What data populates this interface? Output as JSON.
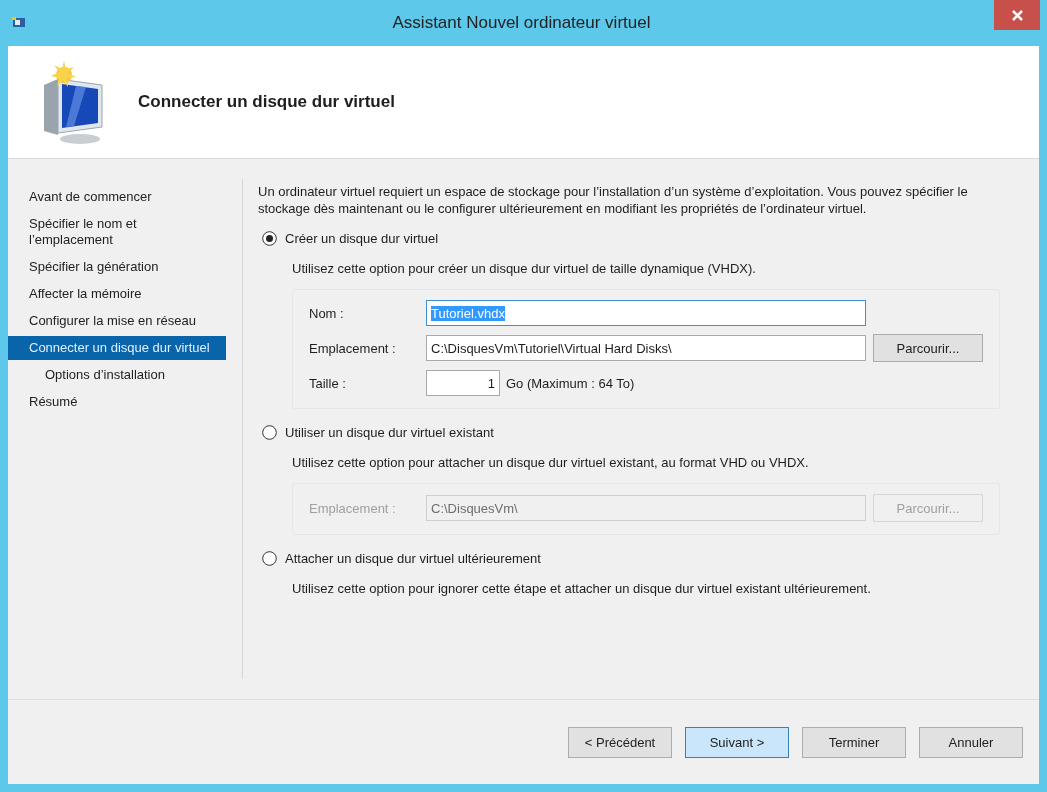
{
  "window": {
    "title": "Assistant Nouvel ordinateur virtuel"
  },
  "header": {
    "title": "Connecter un disque dur virtuel"
  },
  "steps": [
    {
      "label": "Avant de commencer",
      "selected": false
    },
    {
      "label": "Spécifier le nom et l’emplacement",
      "selected": false
    },
    {
      "label": "Spécifier la génération",
      "selected": false
    },
    {
      "label": "Affecter la mémoire",
      "selected": false
    },
    {
      "label": "Configurer la mise en réseau",
      "selected": false
    },
    {
      "label": "Connecter un disque dur virtuel",
      "selected": true,
      "children": [
        {
          "label": "Options d’installation",
          "selected": false
        }
      ]
    },
    {
      "label": "Résumé",
      "selected": false
    }
  ],
  "intro": "Un ordinateur virtuel requiert un espace de stockage pour l’installation d’un système d’exploitation. Vous pouvez spécifier le stockage dès maintenant ou le configurer ultérieurement en modifiant les propriétés de l’ordinateur virtuel.",
  "options": [
    {
      "label": "Créer un disque dur virtuel",
      "selected": true,
      "description": "Utilisez cette option pour créer un disque dur virtuel de taille dynamique (VHDX).",
      "disabled": false,
      "fields": [
        {
          "kind": "text",
          "label": "Nom :",
          "value": "Tutoriel.vhdx",
          "highlighted": true
        },
        {
          "kind": "path",
          "label": "Emplacement :",
          "value": "C:\\DisquesVm\\Tutoriel\\Virtual Hard Disks\\",
          "button": "Parcourir...",
          "highlighted": false
        },
        {
          "kind": "size",
          "label": "Taille :",
          "value": "1",
          "unit": "Go (Maximum : 64 To)",
          "highlighted": false
        }
      ]
    },
    {
      "label": "Utiliser un disque dur virtuel existant",
      "selected": false,
      "description": "Utilisez cette option pour attacher un disque dur virtuel existant, au format VHD ou VHDX.",
      "disabled": true,
      "fields": [
        {
          "kind": "path",
          "label": "Emplacement :",
          "value": "C:\\DisquesVm\\",
          "button": "Parcourir...",
          "highlighted": false
        }
      ]
    },
    {
      "label": "Attacher un disque dur virtuel ultérieurement",
      "selected": false,
      "description": "Utilisez cette option pour ignorer cette étape et attacher un disque dur virtuel existant ultérieurement."
    }
  ],
  "buttons": [
    {
      "label": "< Précédent",
      "focused": false
    },
    {
      "label": "Suivant >",
      "focused": true
    },
    {
      "label": "Terminer",
      "focused": false
    },
    {
      "label": "Annuler",
      "focused": false
    }
  ]
}
